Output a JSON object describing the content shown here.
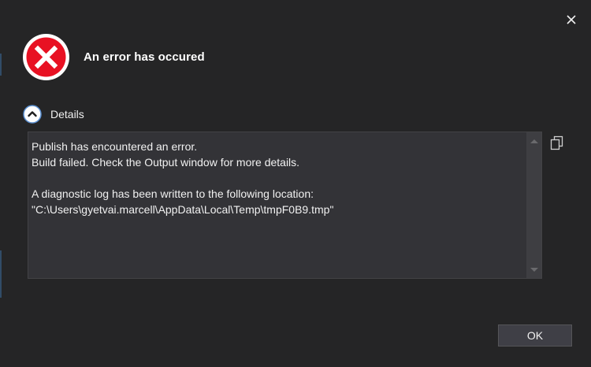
{
  "dialog": {
    "title": "An error has occured",
    "close_icon": "close-icon",
    "status_icon": "error-icon",
    "colors": {
      "background": "#252526",
      "error_red": "#e81123",
      "text": "#f1f1f1",
      "box_background": "#333337"
    }
  },
  "details": {
    "toggle_label": "Details",
    "toggle_icon": "chevron-up-circle-icon",
    "text": "Publish has encountered an error.\nBuild failed. Check the Output window for more details.\n\nA diagnostic log has been written to the following location:\n\"C:\\Users\\gyetvai.marcell\\AppData\\Local\\Temp\\tmpF0B9.tmp\"",
    "copy_icon": "copy-icon"
  },
  "buttons": {
    "ok_label": "OK"
  }
}
